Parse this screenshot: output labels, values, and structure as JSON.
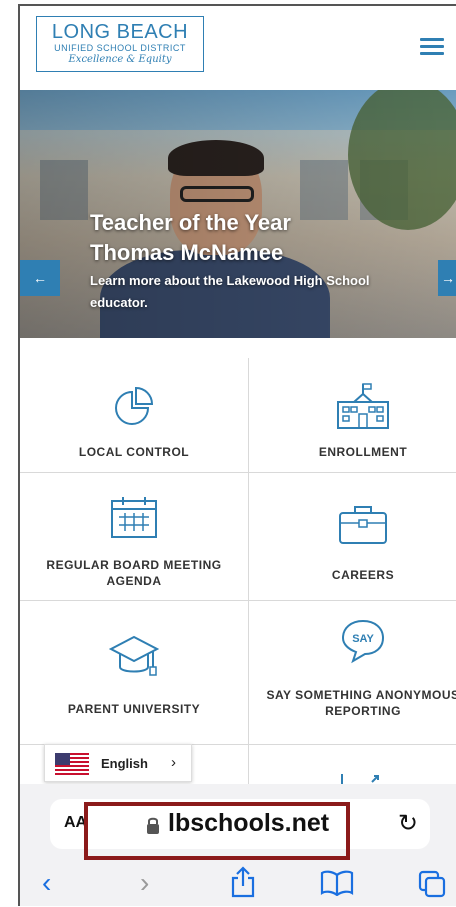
{
  "header": {
    "logo_line1": "LONG BEACH",
    "logo_line2": "UNIFIED SCHOOL DISTRICT",
    "logo_tagline": "Excellence & Equity"
  },
  "hero": {
    "title_line1": "Teacher of the Year",
    "title_line2": "Thomas McNamee",
    "subtitle": "Learn more about the Lakewood High School educator.",
    "prev_arrow": "←",
    "next_arrow": "→"
  },
  "tiles": [
    {
      "label": "LOCAL CONTROL",
      "icon": "pie-chart-icon"
    },
    {
      "label": "ENROLLMENT",
      "icon": "school-building-icon"
    },
    {
      "label": "REGULAR BOARD MEETING AGENDA",
      "icon": "calendar-icon"
    },
    {
      "label": "CAREERS",
      "icon": "briefcase-icon"
    },
    {
      "label": "PARENT UNIVERSITY",
      "icon": "graduation-cap-icon"
    },
    {
      "label": "SAY SOMETHING ANONYMOUS REPORTING",
      "icon": "say-bubble-icon",
      "icon_text": "SAY"
    }
  ],
  "language": {
    "label": "English",
    "chevron": "›"
  },
  "browser": {
    "aa_label": "AA",
    "url": "lbschools.net",
    "accent": "#1a6fe0",
    "highlight_color": "#8b1a1a"
  },
  "colors": {
    "brand": "#2f7fb3"
  }
}
